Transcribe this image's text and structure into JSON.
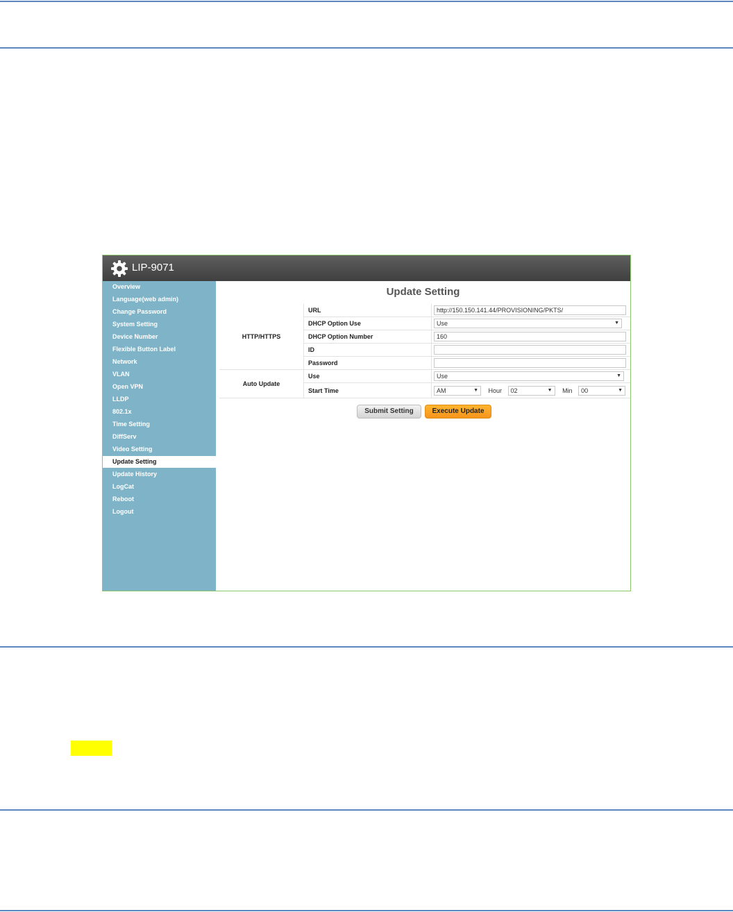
{
  "app": {
    "title": "LIP-9071"
  },
  "sidebar": {
    "items": [
      {
        "label": "Overview"
      },
      {
        "label": "Language(web admin)"
      },
      {
        "label": "Change Password"
      },
      {
        "label": "System Setting"
      },
      {
        "label": "Device Number"
      },
      {
        "label": "Flexible Button Label"
      },
      {
        "label": "Network"
      },
      {
        "label": "VLAN"
      },
      {
        "label": "Open VPN"
      },
      {
        "label": "LLDP"
      },
      {
        "label": "802.1x"
      },
      {
        "label": "Time Setting"
      },
      {
        "label": "DiffServ"
      },
      {
        "label": "Video Setting"
      },
      {
        "label": "Update Setting",
        "active": true
      },
      {
        "label": "Update History"
      },
      {
        "label": "LogCat"
      },
      {
        "label": "Reboot"
      },
      {
        "label": "Logout"
      }
    ]
  },
  "main": {
    "title": "Update Setting",
    "http": {
      "group_label": "HTTP/HTTPS",
      "url_label": "URL",
      "url_value": "http://150.150.141.44/PROVISIONING/PKTS/",
      "dhcp_use_label": "DHCP Option Use",
      "dhcp_use_value": "Use",
      "dhcp_number_label": "DHCP Option Number",
      "dhcp_number_value": "160",
      "id_label": "ID",
      "id_value": "",
      "password_label": "Password",
      "password_value": ""
    },
    "auto_update": {
      "group_label": "Auto Update",
      "use_label": "Use",
      "use_value": "Use",
      "start_time_label": "Start Time",
      "ampm_value": "AM",
      "hour_label": "Hour",
      "hour_value": "02",
      "min_label": "Min",
      "min_value": "00"
    },
    "buttons": {
      "submit_label": "Submit Setting",
      "execute_label": "Execute Update"
    }
  },
  "icons": {
    "logo": "gear-icon",
    "dropdown": "chevron-down-icon"
  },
  "colors": {
    "sidebar": "#7fb4c8",
    "execute_button": "#f7941d",
    "highlight": "#ffff00",
    "rule": "#5b86c0"
  }
}
